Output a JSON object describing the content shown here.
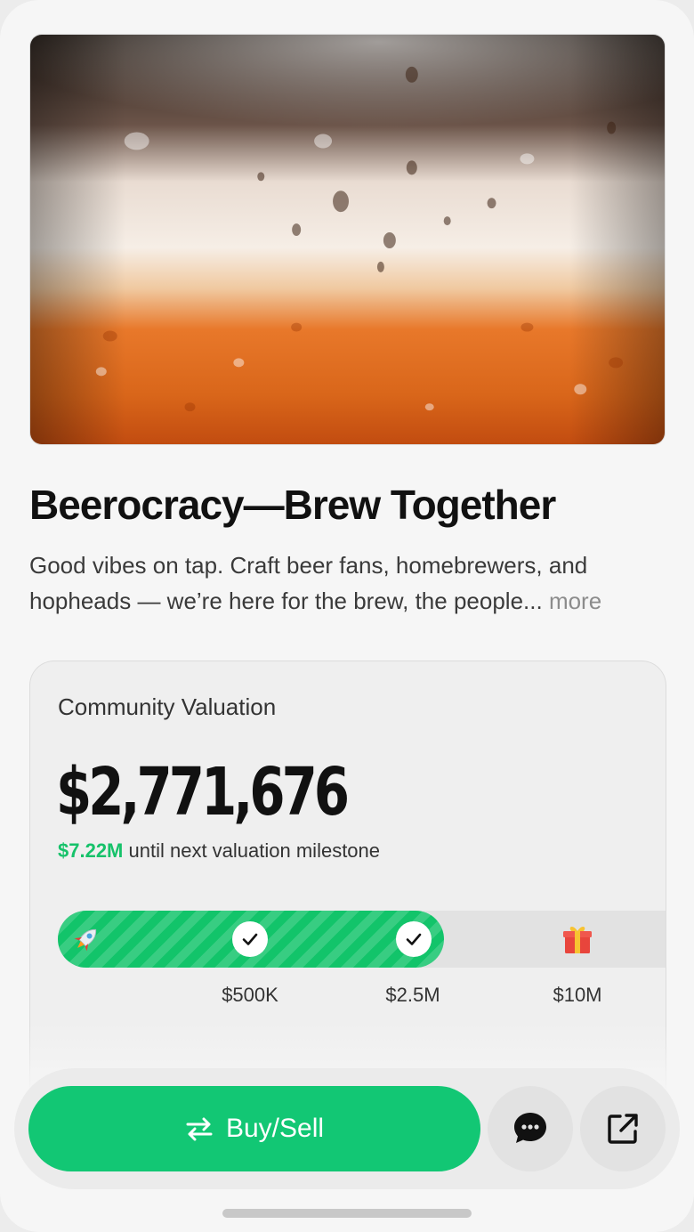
{
  "community": {
    "title": "Beerocracy—Brew Together",
    "description": "Good vibes on tap. Craft beer fans, homebrewers, and hopheads — we’re here for the brew, the people...",
    "more_label": "more"
  },
  "valuation": {
    "label": "Community Valuation",
    "value": "$2,771,676",
    "next_amount": "$7.22M",
    "next_text": "until next valuation milestone",
    "progress_fraction": 0.62,
    "milestones": [
      {
        "label": "$500K",
        "reached": true
      },
      {
        "label": "$2.5M",
        "reached": true
      },
      {
        "label": "$10M",
        "reached": false
      }
    ]
  },
  "actions": {
    "buy_sell_label": "Buy/Sell",
    "chat_icon": "chat-bubble-icon",
    "share_icon": "share-icon"
  },
  "colors": {
    "accent_green": "#12c774",
    "progress_green": "#12c46a",
    "beer_amber": "#d9661a"
  }
}
